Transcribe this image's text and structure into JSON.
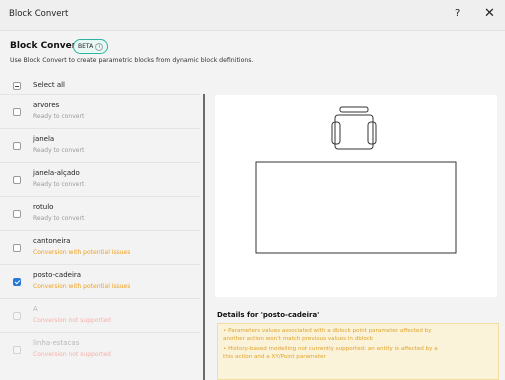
{
  "window": {
    "title": "Block Convert",
    "help_label": "?",
    "close_label": "✕"
  },
  "header": {
    "title": "Block Convert",
    "badge": "BETA",
    "subtitle": "Use Block Convert to create parametric blocks from dynamic block definitions."
  },
  "list": {
    "select_all_label": "Select all",
    "select_all_state": "partial",
    "items": [
      {
        "name": "arvores",
        "status": "Ready to convert",
        "status_type": "ready",
        "checked": false,
        "disabled": false
      },
      {
        "name": "janela",
        "status": "Ready to convert",
        "status_type": "ready",
        "checked": false,
        "disabled": false
      },
      {
        "name": "janela-alçado",
        "status": "Ready to convert",
        "status_type": "ready",
        "checked": false,
        "disabled": false
      },
      {
        "name": "rotulo",
        "status": "Ready to convert",
        "status_type": "ready",
        "checked": false,
        "disabled": false
      },
      {
        "name": "cantoneira",
        "status": "Conversion with potential issues",
        "status_type": "warn",
        "checked": false,
        "disabled": false
      },
      {
        "name": "posto-cadeira",
        "status": "Conversion with potential issues",
        "status_type": "warn",
        "checked": true,
        "disabled": false
      },
      {
        "name": "A",
        "status": "Conversion not supported",
        "status_type": "err",
        "checked": false,
        "disabled": true
      },
      {
        "name": "linha-estacas",
        "status": "Conversion not supported",
        "status_type": "err",
        "checked": false,
        "disabled": true
      }
    ]
  },
  "details": {
    "title": "Details for 'posto-cadeira'",
    "issues": [
      "• Parameters values associated with a dblock point parameter affected by",
      "another action won't match previous values in dblock",
      "• History-based modelling not currently supported: an entity is affected by a",
      "this action and a XY/Point parameter"
    ]
  },
  "colors": {
    "accent": "#2a78d6",
    "beta_border": "#2ab5a0",
    "warning": "#f0a020",
    "error": "#f4b0a8"
  }
}
